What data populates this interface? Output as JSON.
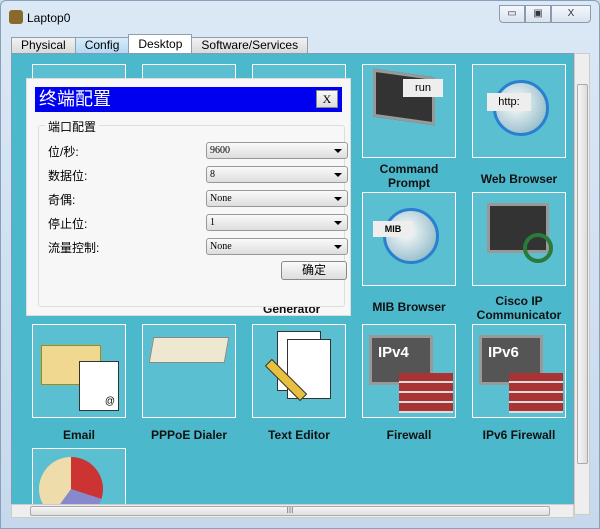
{
  "window": {
    "title": "Laptop0",
    "minimize": "▭",
    "maximize": "▣",
    "close": "X"
  },
  "tabs": [
    {
      "label": "Physical"
    },
    {
      "label": "Config"
    },
    {
      "label": "Desktop"
    },
    {
      "label": "Software/Services"
    }
  ],
  "active_tab": "Desktop",
  "apps": [
    {
      "label": "Command Prompt",
      "icon": "command-prompt-icon",
      "badge": "run"
    },
    {
      "label": "Web Browser",
      "icon": "web-browser-icon",
      "badge": "http:"
    },
    {
      "label": "MIB Browser",
      "icon": "mib-browser-icon",
      "badge": "MIB"
    },
    {
      "label": "Cisco IP Communicator",
      "icon": "ip-communicator-icon"
    },
    {
      "label": "Email",
      "icon": "email-icon"
    },
    {
      "label": "PPPoE Dialer",
      "icon": "pppoe-dialer-icon"
    },
    {
      "label": "Text Editor",
      "icon": "text-editor-icon"
    },
    {
      "label": "Firewall",
      "icon": "firewall-icon",
      "badge": "IPv4"
    },
    {
      "label": "IPv6 Firewall",
      "icon": "ipv6-firewall-icon",
      "badge": "IPv6"
    },
    {
      "label": "Generator",
      "icon": "generator-icon"
    }
  ],
  "dialog": {
    "title": "终端配置",
    "close": "X",
    "group": "端口配置",
    "fields": [
      {
        "label": "位/秒:",
        "value": "9600"
      },
      {
        "label": "数据位:",
        "value": "8"
      },
      {
        "label": "奇偶:",
        "value": "None"
      },
      {
        "label": "停止位:",
        "value": "1"
      },
      {
        "label": "流量控制:",
        "value": "None"
      }
    ],
    "ok": "确定"
  },
  "colors": {
    "desktop": "#4cb8cc",
    "dialog_title": "#0000f0"
  }
}
